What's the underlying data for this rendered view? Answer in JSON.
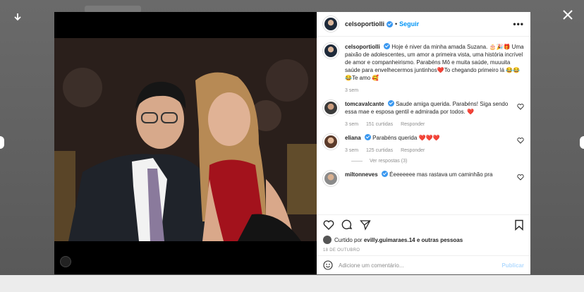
{
  "post": {
    "author": "celsoportiolli",
    "follow_label": "Seguir",
    "dot": "•",
    "more": "•••"
  },
  "caption": {
    "username": "celsoportiolli",
    "text": "Hoje é niver da minha amada Suzana. 🎂🎉🎁 Uma paixão de adolescentes, um amor a primeira vista, uma história incrível de amor e companheirismo. Parabéns Mô e muita saúde, muuuita saúde para envelhecermos juntinhos❤️To chegando primeiro lá 😂😂😂Te amo 🥰",
    "time": "3 sem"
  },
  "comments": [
    {
      "username": "tomcavalcante",
      "text": "Saude amiga querida. Parabéns! Siga sendo essa mae e esposa gentil e admirada por todos. ❤️",
      "time": "3 sem",
      "likes": "151 curtidas",
      "reply": "Responder"
    },
    {
      "username": "eliana",
      "text": "Parabéns querida ❤️❤️❤️",
      "time": "3 sem",
      "likes": "125 curtidas",
      "reply": "Responder",
      "view_replies": "Ver respostas (3)"
    },
    {
      "username": "miltonneves",
      "text": "Éeeeeeee mas rastava um caminhão pra"
    }
  ],
  "likes_line": {
    "prefix": "Curtido por",
    "user": "evilly.guimaraes.14",
    "suffix": "e outras pessoas"
  },
  "date": "18 DE OUTUBRO",
  "add_comment": {
    "placeholder": "Adicione um comentário...",
    "publish": "Publicar"
  },
  "colors": {
    "accent": "#0095f6",
    "verified": "#3897f0",
    "heart": "#ed4956"
  }
}
